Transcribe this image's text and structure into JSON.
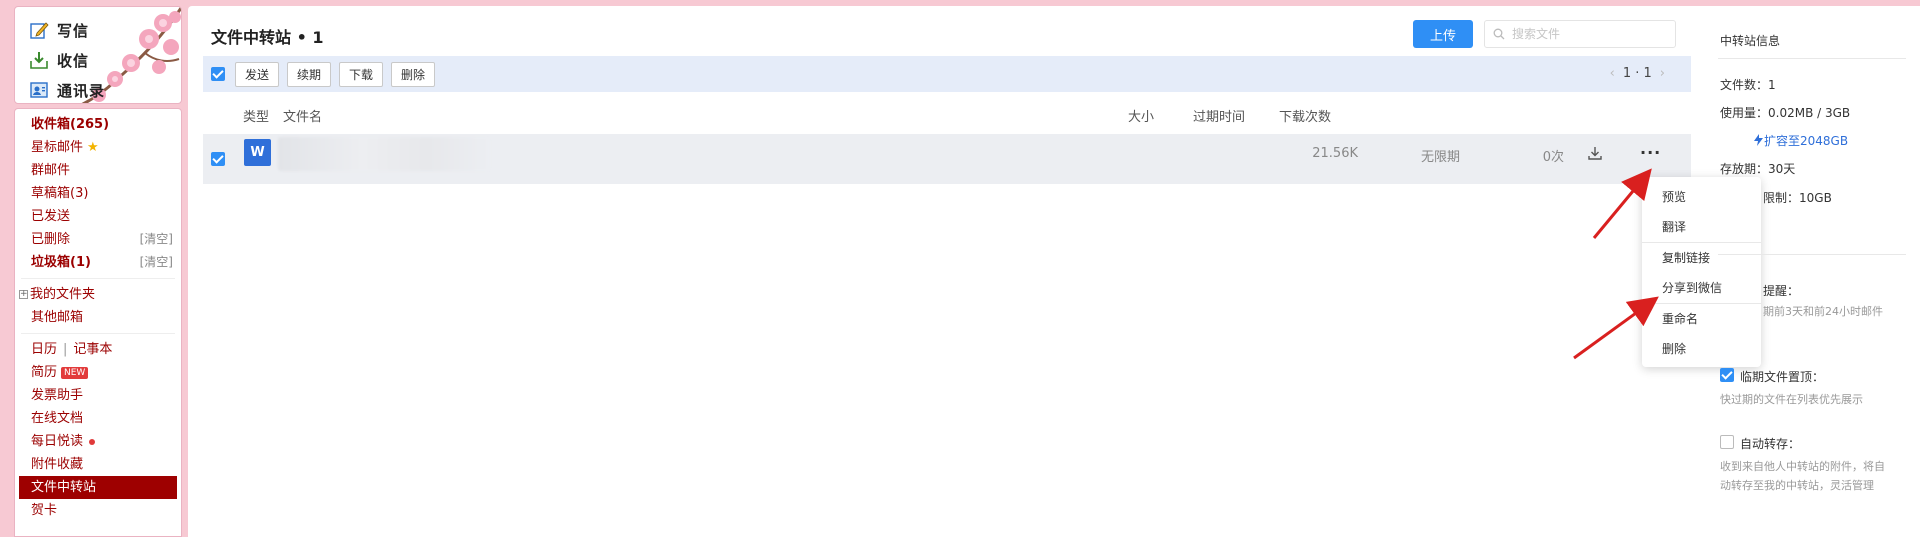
{
  "top_actions": [
    {
      "label": "写信",
      "icon": "compose-icon"
    },
    {
      "label": "收信",
      "icon": "inbox-download-icon"
    },
    {
      "label": "通讯录",
      "icon": "contacts-icon"
    }
  ],
  "nav": {
    "inbox": "收件箱(265)",
    "starred": "星标邮件",
    "group": "群邮件",
    "drafts": "草稿箱(3)",
    "sent": "已发送",
    "deleted": "已删除",
    "deleted_clear": "[清空]",
    "spam": "垃圾箱(1)",
    "spam_clear": "[清空]",
    "my_folders": "我的文件夹",
    "other_mailbox": "其他邮箱",
    "calendar": "日历",
    "divider": "|",
    "notebook": "记事本",
    "resume": "简历",
    "resume_badge": "NEW",
    "invoice": "发票助手",
    "online_docs": "在线文档",
    "daily_read": "每日悦读",
    "attachments": "附件收藏",
    "file_transfer": "文件中转站",
    "cards": "贺卡"
  },
  "main": {
    "title": "文件中转站 • 1",
    "upload": "上传",
    "search_placeholder": "搜索文件",
    "toolbar": {
      "send": "发送",
      "renew": "续期",
      "download": "下载",
      "delete": "删除"
    },
    "pager": "1 · 1",
    "columns": {
      "type": "类型",
      "name": "文件名",
      "size": "大小",
      "expire": "过期时间",
      "downloads": "下载次数"
    },
    "file": {
      "type_glyph": "W",
      "size": "21.56K",
      "expire": "无限期",
      "downloads": "0次"
    }
  },
  "menu": {
    "preview": "预览",
    "translate": "翻译",
    "copy_link": "复制链接",
    "share_wechat": "分享到微信",
    "rename": "重命名",
    "delete": "删除"
  },
  "info": {
    "title": "中转站信息",
    "file_count": "文件数：1",
    "usage": "使用量：0.02MB / 3GB",
    "expand": "扩容至2048GB",
    "retention": "存放期：30天",
    "limit_partial": "限制：10GB",
    "reminder_partial": "提醒：",
    "reminder_desc_partial": "期前3天和前24小时邮件",
    "pin_expiring": "临期文件置顶：",
    "pin_desc": "快过期的文件在列表优先展示",
    "auto_save": "自动转存：",
    "auto_save_desc_1": "收到来自他人中转站的附件，将自",
    "auto_save_desc_2": "动转存至我的中转站，灵活管理"
  },
  "colors": {
    "background_pink": "#f7c9d3",
    "nav_red": "#9b0000",
    "accent_blue": "#2f8ff5",
    "toolbar_bg": "#e5ecf9",
    "annotation_arrow": "#d9201f"
  }
}
